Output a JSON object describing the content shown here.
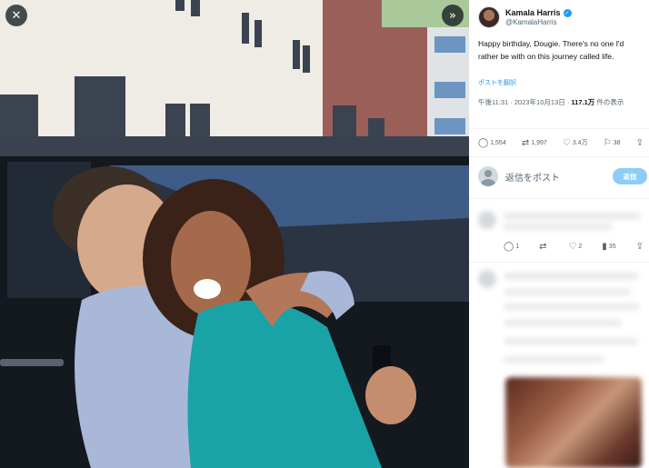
{
  "photo_viewer": {
    "close_icon": "close-icon",
    "expand_icon": "expand-icon"
  },
  "post": {
    "author": {
      "display_name": "Kamala Harris",
      "handle": "@KamalaHarris",
      "verified": true
    },
    "text": "Happy birthday, Dougie. There's no one I'd rather be with on this journey called life.",
    "translate_label": "ポストを翻訳",
    "timestamp": "午後11:31 · 2023年10月13日 · ",
    "views_count": "117.1万",
    "views_suffix": " 件の表示",
    "actions": {
      "replies": "1,554",
      "reposts": "1,997",
      "likes": "3.4万",
      "bookmarks": "38"
    }
  },
  "reply_box": {
    "placeholder": "返信をポスト",
    "button_label": "返信"
  },
  "first_reply": {
    "actions": {
      "replies": "1",
      "reposts": "",
      "likes": "2",
      "views": "35"
    }
  },
  "colors": {
    "accent": "#1d9bf0",
    "reply_button": "#8ecdf8",
    "secondary_text": "#536471"
  }
}
